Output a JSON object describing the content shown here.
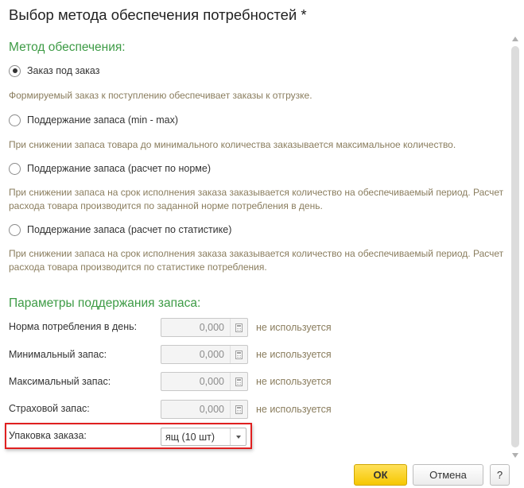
{
  "window": {
    "title": "Выбор метода обеспечения потребностей *"
  },
  "method": {
    "section_title": "Метод обеспечения:",
    "options": [
      {
        "label": "Заказ под заказ",
        "checked": true,
        "description": "Формируемый заказ к поступлению обеспечивает заказы к отгрузке."
      },
      {
        "label": "Поддержание запаса (min - max)",
        "checked": false,
        "description": "При снижении запаса товара до минимального количества заказывается максимальное количество."
      },
      {
        "label": "Поддержание запаса (расчет по норме)",
        "checked": false,
        "description": "При снижении запаса на срок исполнения заказа заказывается количество на обеспечиваемый период. Расчет расхода товара производится по заданной норме потребления в день."
      },
      {
        "label": "Поддержание запаса (расчет по статистике)",
        "checked": false,
        "description": "При снижении запаса на срок исполнения заказа заказывается количество на обеспечиваемый период. Расчет расхода товара производится по статистике потребления."
      }
    ]
  },
  "params": {
    "section_title": "Параметры поддержания запаса:",
    "fields": [
      {
        "label": "Норма потребления в день:",
        "value": "0,000",
        "note": "не используется"
      },
      {
        "label": "Минимальный запас:",
        "value": "0,000",
        "note": "не используется"
      },
      {
        "label": "Максимальный запас:",
        "value": "0,000",
        "note": "не используется"
      },
      {
        "label": "Страховой запас:",
        "value": "0,000",
        "note": "не используется"
      }
    ],
    "package": {
      "label": "Упаковка заказа:",
      "value": "ящ (10 шт)"
    }
  },
  "buttons": {
    "ok": "ОК",
    "cancel": "Отмена",
    "help": "?"
  },
  "colors": {
    "section_title": "#3d9b45",
    "description": "#8a7d5e",
    "highlight": "#e02020",
    "ok_button": "#f6c800"
  }
}
